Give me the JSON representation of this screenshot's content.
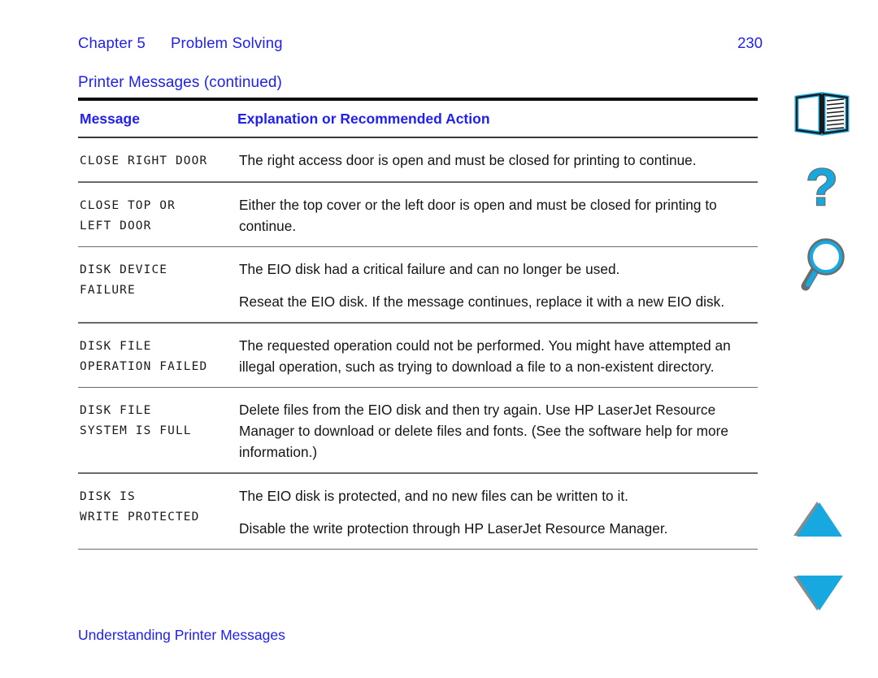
{
  "header": {
    "chapter_label": "Chapter 5",
    "chapter_title": "Problem Solving",
    "page_number": "230"
  },
  "section": {
    "title": "Printer Messages (continued)"
  },
  "table": {
    "columns": {
      "message": "Message",
      "explanation": "Explanation or Recommended Action"
    },
    "rows": [
      {
        "message_lines": [
          "CLOSE RIGHT DOOR"
        ],
        "paragraphs": [
          "The right access door is open and must be closed for printing to continue."
        ]
      },
      {
        "message_lines": [
          "CLOSE TOP OR",
          "LEFT DOOR"
        ],
        "paragraphs": [
          "Either the top cover or the left door is open and must be closed for printing to continue."
        ]
      },
      {
        "message_lines": [
          "DISK DEVICE",
          "FAILURE"
        ],
        "paragraphs": [
          "The EIO disk had a critical failure and can no longer be used.",
          "Reseat the EIO disk. If the message continues, replace it with a new EIO disk."
        ]
      },
      {
        "message_lines": [
          "DISK FILE",
          "OPERATION FAILED"
        ],
        "paragraphs": [
          "The requested operation could not be performed. You might have attempted an illegal operation, such as trying to download a file to a non-existent directory."
        ]
      },
      {
        "message_lines": [
          "DISK FILE",
          "SYSTEM IS FULL"
        ],
        "paragraphs": [
          "Delete files from the EIO disk and then try again. Use HP LaserJet Resource Manager to download or delete files and fonts. (See the software help for more information.)"
        ]
      },
      {
        "message_lines": [
          "DISK IS",
          "WRITE PROTECTED"
        ],
        "paragraphs": [
          "The EIO disk is protected, and no new files can be written to it.",
          "Disable the write protection through HP LaserJet Resource Manager."
        ]
      }
    ]
  },
  "footer": {
    "link_text": "Understanding Printer Messages"
  },
  "sidebar": {
    "icons": [
      {
        "name": "book-icon",
        "label": "Contents"
      },
      {
        "name": "question-mark-icon",
        "label": "Help"
      },
      {
        "name": "magnifier-icon",
        "label": "Search"
      },
      {
        "name": "triangle-up-icon",
        "label": "Previous Page"
      },
      {
        "name": "triangle-down-icon",
        "label": "Next Page"
      }
    ]
  },
  "colors": {
    "link_blue": "#2020f0",
    "icon_cyan": "#18a8e0",
    "icon_shadow": "#6b6b6b",
    "rule_black": "#0d0d0d",
    "rule_gray": "#6a6a6a",
    "body_text": "#141414"
  }
}
